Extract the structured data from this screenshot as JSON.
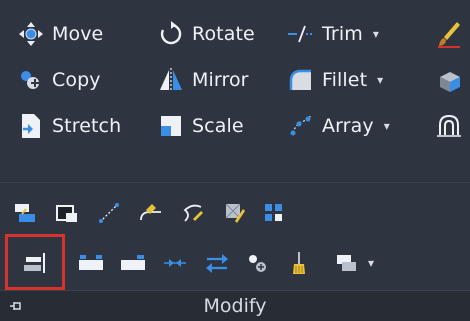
{
  "panel": {
    "title": "Modify"
  },
  "commands": {
    "move": "Move",
    "rotate": "Rotate",
    "trim": "Trim",
    "copy": "Copy",
    "mirror": "Mirror",
    "fillet": "Fillet",
    "stretch": "Stretch",
    "scale": "Scale",
    "array": "Array"
  },
  "dropdown_glyph": "▾",
  "icons": {
    "row1": [
      "move-icon",
      "rotate-icon",
      "trim-icon",
      "paintbrush-icon"
    ],
    "row2": [
      "copy-icon",
      "mirror-icon",
      "fillet-icon",
      "solid-edit-icon"
    ],
    "row3": [
      "stretch-icon",
      "scale-icon",
      "array-icon",
      "offset-icon"
    ],
    "small_row1": [
      "explode-icon",
      "edit-block-icon",
      "lengthen-icon",
      "erase-icon",
      "polyline-edit-icon",
      "match-properties-icon",
      "array-edit-icon"
    ],
    "small_row2": [
      "align-left-icon",
      "break-icon",
      "break-at-point-icon",
      "join-icon",
      "reverse-icon",
      "copy-clip-icon",
      "delete-duplicate-icon",
      "draw-order-icon"
    ]
  },
  "colors": {
    "background": "#2f3540",
    "footer": "#272c35",
    "highlight": "#d8322f",
    "text": "#eef2f7",
    "accent_blue": "#3a8ee6",
    "accent_yellow": "#e8c33a"
  }
}
